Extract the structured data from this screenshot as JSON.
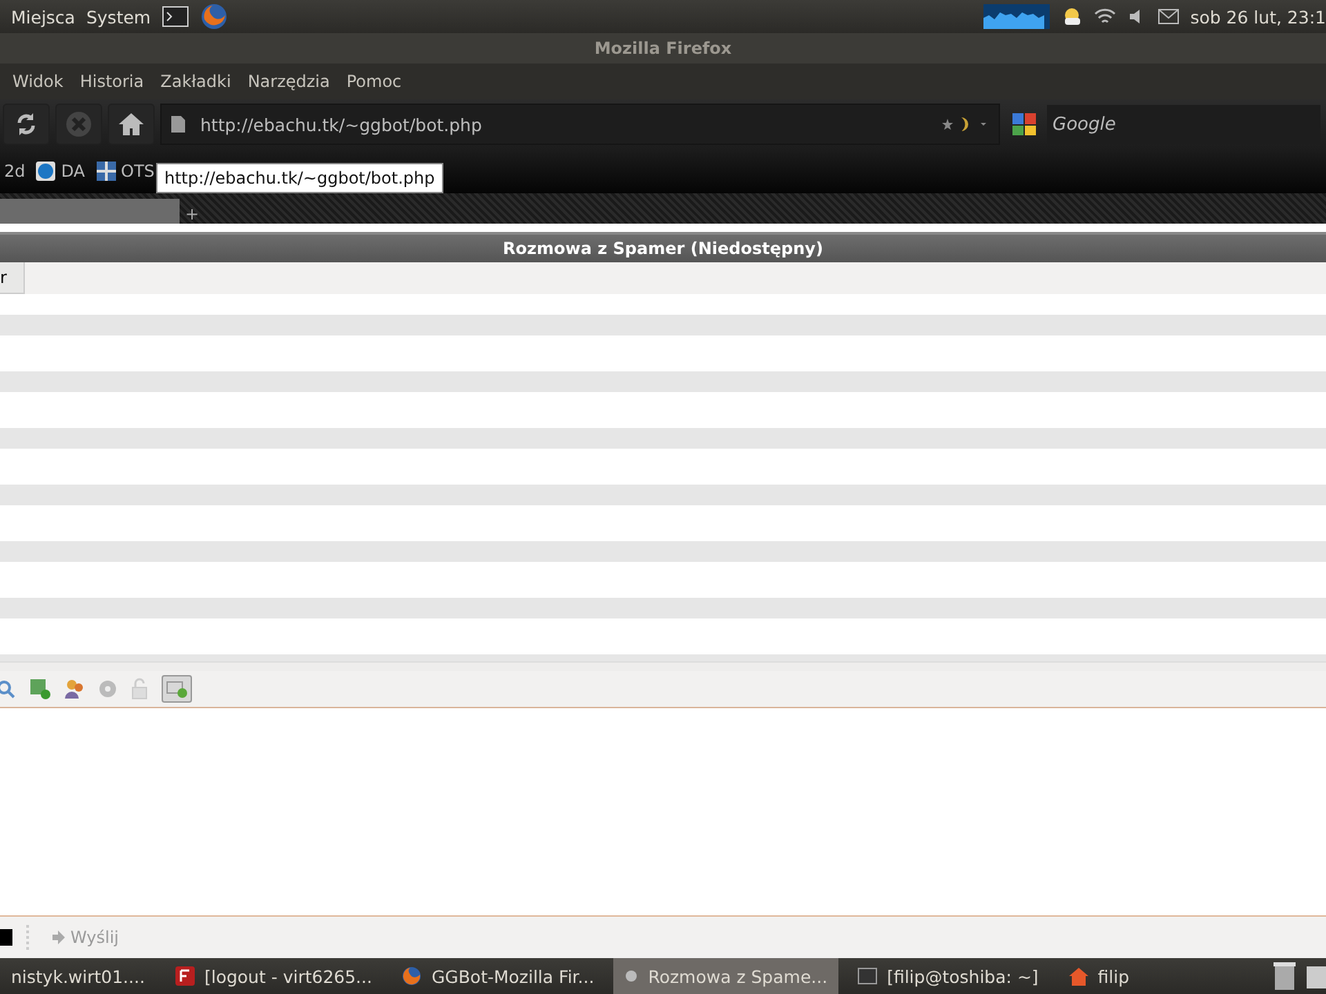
{
  "top_panel": {
    "menus": [
      "Miejsca",
      "System"
    ],
    "clock": "sob 26 lut, 23:1"
  },
  "window": {
    "title": "Mozilla Firefox"
  },
  "menu_bar": [
    "Widok",
    "Historia",
    "Zakładki",
    "Narzędzia",
    "Pomoc"
  ],
  "address_bar": {
    "value": "http://ebachu.tk/~ggbot/bot.php"
  },
  "search": {
    "placeholder": "Google"
  },
  "bookmarks": [
    {
      "label": "2d",
      "kind": "none"
    },
    {
      "label": "DA",
      "kind": "circle"
    },
    {
      "label": "OTS",
      "kind": "grid"
    }
  ],
  "tooltip": "http://ebachu.tk/~ggbot/bot.php",
  "tab_bar": {
    "new_tab": "+"
  },
  "chat": {
    "title": "Rozmowa z Spamer (Niedostępny)",
    "column_1": "r",
    "send": "Wyślij"
  },
  "taskbar": [
    {
      "label": "nistyk.wirt01....",
      "kind": "none",
      "selected": false
    },
    {
      "label": "[logout - virt6265...",
      "kind": "filezilla",
      "selected": false
    },
    {
      "label": "GGBot-Mozilla Fir...",
      "kind": "firefox",
      "selected": false
    },
    {
      "label": "Rozmowa z Spame...",
      "kind": "dot",
      "selected": true
    },
    {
      "label": "[filip@toshiba: ~]",
      "kind": "terminal",
      "selected": false
    },
    {
      "label": "filip",
      "kind": "home",
      "selected": false
    }
  ]
}
